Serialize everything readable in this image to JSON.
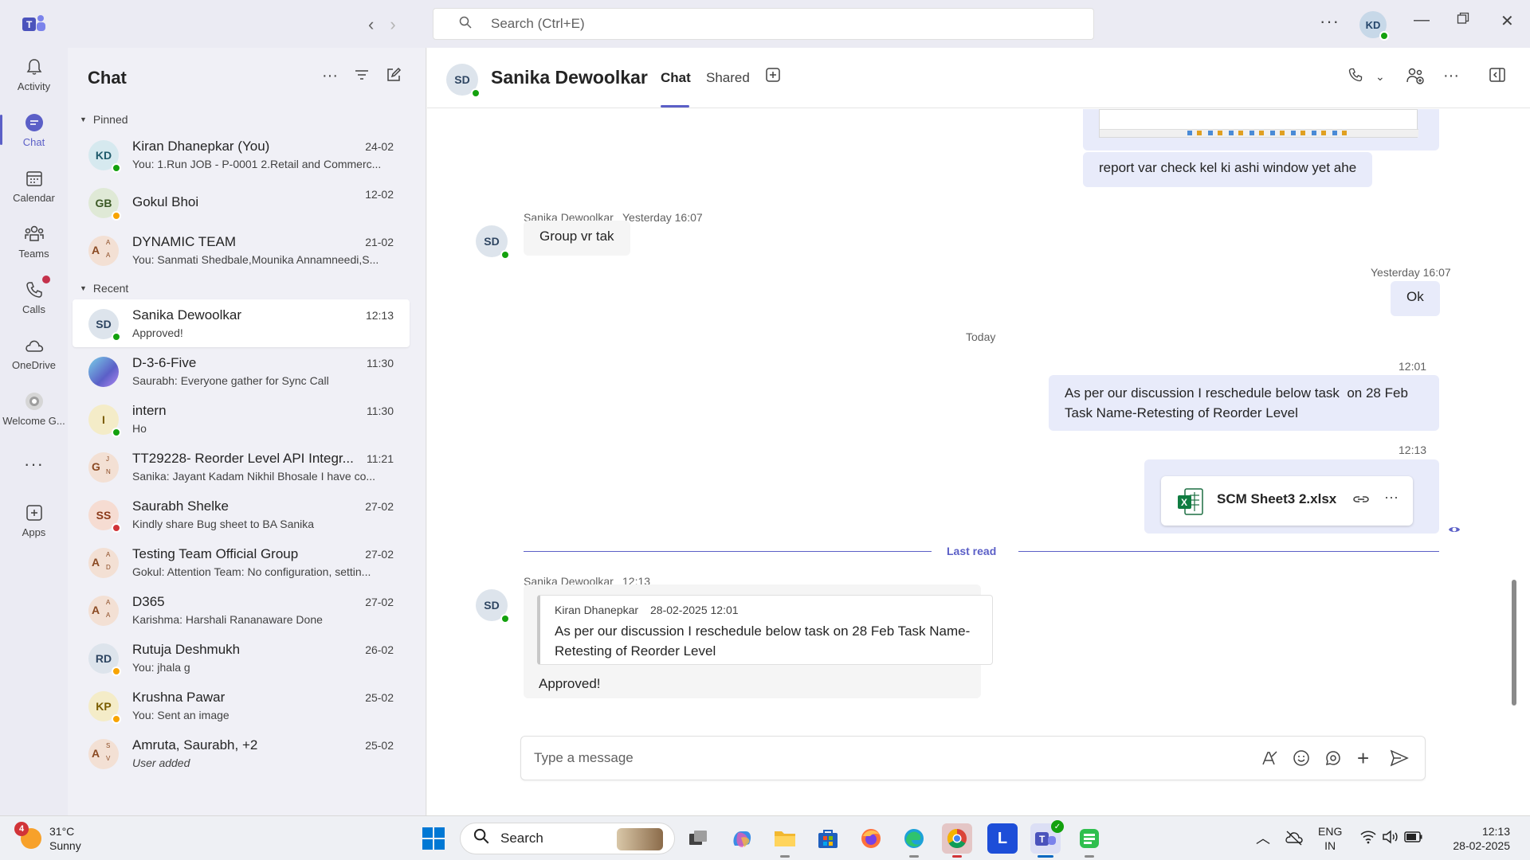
{
  "titlebar": {
    "search_placeholder": "Search (Ctrl+E)",
    "user_initials": "KD"
  },
  "rail": [
    {
      "label": "Activity",
      "icon": "bell-icon"
    },
    {
      "label": "Chat",
      "icon": "chat-icon",
      "active": true
    },
    {
      "label": "Calendar",
      "icon": "calendar-icon"
    },
    {
      "label": "Teams",
      "icon": "teams-icon"
    },
    {
      "label": "Calls",
      "icon": "phone-icon",
      "badge": true
    },
    {
      "label": "OneDrive",
      "icon": "cloud-icon"
    },
    {
      "label": "Welcome G...",
      "icon": "welcome-icon"
    },
    {
      "label": "Apps",
      "icon": "apps-icon"
    }
  ],
  "chatlist": {
    "title": "Chat",
    "pinned_label": "Pinned",
    "recent_label": "Recent",
    "pinned": [
      {
        "initials": "KD",
        "name": "Kiran Dhanepkar (You)",
        "preview": "You: 1.Run JOB - P-0001 2.Retail and Commerc...",
        "time": "24-02",
        "presence": "available",
        "color": "#d6e9ef",
        "text": "#1f5a6b"
      },
      {
        "initials": "GB",
        "name": "Gokul Bhoi",
        "preview": "",
        "time": "12-02",
        "presence": "away",
        "color": "#dfe9d6",
        "text": "#3c5a26"
      },
      {
        "group": true,
        "g1": "A",
        "g2": "A",
        "g3": "A",
        "name": "DYNAMIC TEAM",
        "preview": "You: Sanmati Shedbale,Mounika Annamneedi,S...",
        "time": "21-02"
      }
    ],
    "recent": [
      {
        "initials": "SD",
        "name": "Sanika Dewoolkar",
        "preview": "Approved!",
        "time": "12:13",
        "presence": "available",
        "color": "#dde4ec",
        "text": "#2f4662",
        "selected": true
      },
      {
        "image": true,
        "name": "D-3-6-Five",
        "preview": "Saurabh: Everyone gather for Sync Call",
        "time": "11:30"
      },
      {
        "initials": "I",
        "name": "intern",
        "preview": "Ho",
        "time": "11:30",
        "presence": "available",
        "color": "#f4ecc8",
        "text": "#7a5c00"
      },
      {
        "group": true,
        "g1": "G",
        "g2": "J",
        "g3": "N",
        "name": "TT29228- Reorder Level API Integr...",
        "preview": "Sanika: Jayant Kadam Nikhil Bhosale I have co...",
        "time": "11:21"
      },
      {
        "initials": "SS",
        "name": "Saurabh Shelke",
        "preview": "Kindly share Bug sheet to BA Sanika",
        "time": "27-02",
        "presence": "busy",
        "color": "#f6dcd2",
        "text": "#8b3a1a"
      },
      {
        "group": true,
        "g1": "A",
        "g2": "A",
        "g3": "D",
        "name": "Testing Team Official Group",
        "preview": "Gokul: Attention Team: No configuration, settin...",
        "time": "27-02"
      },
      {
        "group": true,
        "g1": "A",
        "g2": "A",
        "g3": "A",
        "name": "D365",
        "preview": "Karishma: Harshali Rananaware Done",
        "time": "27-02"
      },
      {
        "initials": "RD",
        "name": "Rutuja Deshmukh",
        "preview": "You: jhala g",
        "time": "26-02",
        "presence": "away",
        "color": "#dde4ec",
        "text": "#2f4662"
      },
      {
        "initials": "KP",
        "name": "Krushna Pawar",
        "preview": "You: Sent an image",
        "time": "25-02",
        "presence": "away",
        "color": "#f4ecc8",
        "text": "#7a5c00"
      },
      {
        "group": true,
        "g1": "A",
        "g2": "S",
        "g3": "V",
        "name": "Amruta, Saurabh, +2",
        "preview": "User added",
        "time": "25-02",
        "italic": true
      }
    ]
  },
  "conversation": {
    "initials": "SD",
    "name": "Sanika Dewoolkar",
    "tabs": [
      "Chat",
      "Shared"
    ],
    "msg1": "report var check kel ki ashi window yet ahe",
    "msg2_sender": "Sanika Dewoolkar",
    "msg2_time": "Yesterday 16:07",
    "msg2": "Group vr tak",
    "msg3_time": "Yesterday 16:07",
    "msg3": "Ok",
    "day_divider": "Today",
    "msg4_time": "12:01",
    "msg4_line1": "As per our discussion I reschedule below task  on 28 Feb",
    "msg4_line2": "Task Name-Retesting of Reorder Level",
    "msg5_time": "12:13",
    "file_name": "SCM Sheet3 2.xlsx",
    "last_read": "Last read",
    "msg6_sender": "Sanika Dewoolkar",
    "msg6_time": "12:13",
    "quote_author": "Kiran Dhanepkar",
    "quote_time": "28-02-2025 12:01",
    "quote_line1": "As per our discussion I reschedule below task on 28 Feb Task Name-",
    "quote_line2": "Retesting of Reorder Level",
    "msg6": "Approved!",
    "composer_placeholder": "Type a message"
  },
  "taskbar": {
    "weather_badge": "4",
    "temp": "31°C",
    "condition": "Sunny",
    "search_label": "Search",
    "lang1": "ENG",
    "lang2": "IN",
    "time": "12:13",
    "date": "28-02-2025"
  },
  "colors": {
    "accent": "#5b5fc7",
    "available": "#13a10e",
    "away": "#f8a400",
    "busy": "#d13438"
  }
}
